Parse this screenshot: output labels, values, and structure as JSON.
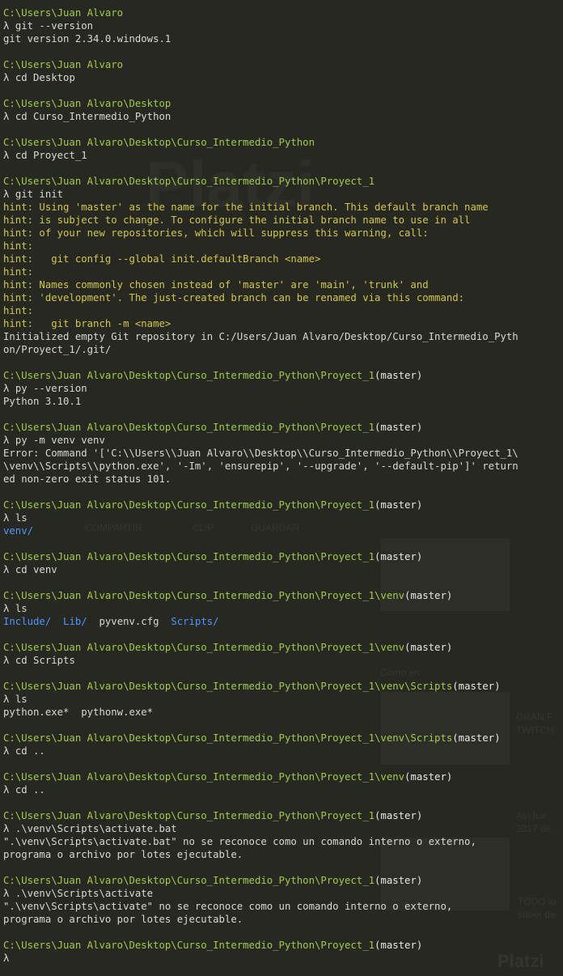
{
  "terminal": {
    "colors": {
      "background": "#272822",
      "path": "#a6c84a",
      "hint": "#cfc84a",
      "directory": "#4f96ff",
      "text": "#d8d8d8"
    },
    "prompt_symbol": "λ",
    "blocks": [
      {
        "path": "C:\\Users\\Juan Alvaro",
        "branch": "",
        "command": "git --version",
        "output": [
          {
            "text": "git version 2.34.0.windows.1",
            "style": "out"
          }
        ]
      },
      {
        "path": "C:\\Users\\Juan Alvaro",
        "branch": "",
        "command": "cd Desktop",
        "output": []
      },
      {
        "path": "C:\\Users\\Juan Alvaro\\Desktop",
        "branch": "",
        "command": "cd Curso_Intermedio_Python",
        "output": []
      },
      {
        "path": "C:\\Users\\Juan Alvaro\\Desktop\\Curso_Intermedio_Python",
        "branch": "",
        "command": "cd Proyect_1",
        "output": []
      },
      {
        "path": "C:\\Users\\Juan Alvaro\\Desktop\\Curso_Intermedio_Python\\Proyect_1",
        "branch": "",
        "command": "git init",
        "output": [
          {
            "text": "hint: Using 'master' as the name for the initial branch. This default branch name",
            "style": "hint"
          },
          {
            "text": "hint: is subject to change. To configure the initial branch name to use in all",
            "style": "hint"
          },
          {
            "text": "hint: of your new repositories, which will suppress this warning, call:",
            "style": "hint"
          },
          {
            "text": "hint:",
            "style": "hint"
          },
          {
            "text": "hint:   git config --global init.defaultBranch <name>",
            "style": "hint"
          },
          {
            "text": "hint:",
            "style": "hint"
          },
          {
            "text": "hint: Names commonly chosen instead of 'master' are 'main', 'trunk' and",
            "style": "hint"
          },
          {
            "text": "hint: 'development'. The just-created branch can be renamed via this command:",
            "style": "hint"
          },
          {
            "text": "hint:",
            "style": "hint"
          },
          {
            "text": "hint:   git branch -m <name>",
            "style": "hint"
          },
          {
            "text": "Initialized empty Git repository in C:/Users/Juan Alvaro/Desktop/Curso_Intermedio_Pyth",
            "style": "out"
          },
          {
            "text": "on/Proyect_1/.git/",
            "style": "out"
          }
        ]
      },
      {
        "path": "C:\\Users\\Juan Alvaro\\Desktop\\Curso_Intermedio_Python\\Proyect_1",
        "branch": "(master)",
        "command": "py --version",
        "output": [
          {
            "text": "Python 3.10.1",
            "style": "out"
          }
        ]
      },
      {
        "path": "C:\\Users\\Juan Alvaro\\Desktop\\Curso_Intermedio_Python\\Proyect_1",
        "branch": "(master)",
        "command": "py -m venv venv",
        "output": [
          {
            "text": "Error: Command '['C:\\\\Users\\\\Juan Alvaro\\\\Desktop\\\\Curso_Intermedio_Python\\\\Proyect_1\\",
            "style": "out"
          },
          {
            "text": "\\venv\\\\Scripts\\\\python.exe', '-Im', 'ensurepip', '--upgrade', '--default-pip']' return",
            "style": "out"
          },
          {
            "text": "ed non-zero exit status 101.",
            "style": "out"
          }
        ]
      },
      {
        "path": "C:\\Users\\Juan Alvaro\\Desktop\\Curso_Intermedio_Python\\Proyect_1",
        "branch": "(master)",
        "command": "ls",
        "output": [
          {
            "items": [
              {
                "text": "venv/",
                "style": "dir"
              }
            ]
          }
        ]
      },
      {
        "path": "C:\\Users\\Juan Alvaro\\Desktop\\Curso_Intermedio_Python\\Proyect_1",
        "branch": "(master)",
        "command": "cd venv",
        "output": []
      },
      {
        "path": "C:\\Users\\Juan Alvaro\\Desktop\\Curso_Intermedio_Python\\Proyect_1\\venv",
        "branch": "(master)",
        "command": "ls",
        "output": [
          {
            "items": [
              {
                "text": "Include/",
                "style": "dir"
              },
              {
                "text": "  ",
                "style": "out"
              },
              {
                "text": "Lib/",
                "style": "dir"
              },
              {
                "text": "  pyvenv.cfg  ",
                "style": "file"
              },
              {
                "text": "Scripts/",
                "style": "dir"
              }
            ]
          }
        ]
      },
      {
        "path": "C:\\Users\\Juan Alvaro\\Desktop\\Curso_Intermedio_Python\\Proyect_1\\venv",
        "branch": "(master)",
        "command": "cd Scripts",
        "output": []
      },
      {
        "path": "C:\\Users\\Juan Alvaro\\Desktop\\Curso_Intermedio_Python\\Proyect_1\\venv\\Scripts",
        "branch": "(master)",
        "command": "ls",
        "output": [
          {
            "items": [
              {
                "text": "python.exe*  pythonw.exe*",
                "style": "file"
              }
            ]
          }
        ]
      },
      {
        "path": "C:\\Users\\Juan Alvaro\\Desktop\\Curso_Intermedio_Python\\Proyect_1\\venv\\Scripts",
        "branch": "(master)",
        "command": "cd ..",
        "output": []
      },
      {
        "path": "C:\\Users\\Juan Alvaro\\Desktop\\Curso_Intermedio_Python\\Proyect_1\\venv",
        "branch": "(master)",
        "command": "cd ..",
        "output": []
      },
      {
        "path": "C:\\Users\\Juan Alvaro\\Desktop\\Curso_Intermedio_Python\\Proyect_1",
        "branch": "(master)",
        "command": ".\\venv\\Scripts\\activate.bat",
        "output": [
          {
            "text": "\".\\venv\\Scripts\\activate.bat\" no se reconoce como un comando interno o externo,",
            "style": "out"
          },
          {
            "text": "programa o archivo por lotes ejecutable.",
            "style": "out"
          }
        ]
      },
      {
        "path": "C:\\Users\\Juan Alvaro\\Desktop\\Curso_Intermedio_Python\\Proyect_1",
        "branch": "(master)",
        "command": ".\\venv\\Scripts\\activate",
        "output": [
          {
            "text": "\".\\venv\\Scripts\\activate\" no se reconoce como un comando interno o externo,",
            "style": "out"
          },
          {
            "text": "programa o archivo por lotes ejecutable.",
            "style": "out"
          }
        ]
      },
      {
        "path": "C:\\Users\\Juan Alvaro\\Desktop\\Curso_Intermedio_Python\\Proyect_1",
        "branch": "(master)",
        "command": "",
        "output": []
      }
    ]
  },
  "watermark": {
    "logo_text": "Platzi",
    "lines": [
      "COMPARTIR",
      "CLIP",
      "GUARDAR",
      "Cómo en",
      "GRAN F",
      "TWITCH",
      "Así fue",
      "2017 de",
      "TODO lo",
      "saber de",
      "Platzi"
    ]
  }
}
